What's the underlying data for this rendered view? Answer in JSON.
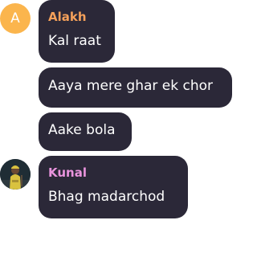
{
  "messages": [
    {
      "sender": "Alakh",
      "sender_color": "#f4a05a",
      "avatar_initial": "A",
      "avatar_color": "#fbb54d",
      "text": "Kal raat"
    },
    {
      "text": "Aaya mere ghar ek chor"
    },
    {
      "text": "Aake bola"
    },
    {
      "sender": "Kunal",
      "sender_color": "#e994dd",
      "avatar_icon": "person-photo-icon",
      "text": "Bhag madarchod"
    }
  ],
  "colors": {
    "bubble": "#2b2838",
    "text": "#ffffff"
  }
}
